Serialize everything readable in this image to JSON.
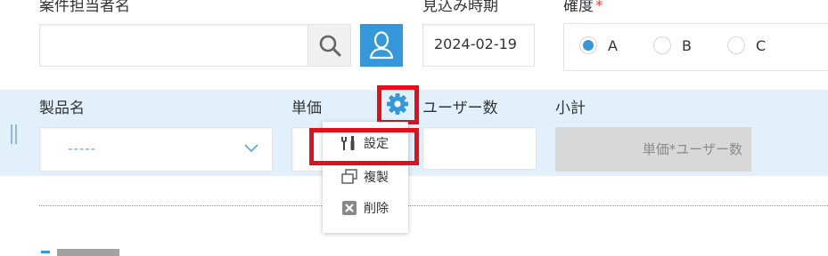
{
  "top_section": {
    "person_label": "案件担当者名",
    "person_value": "",
    "prospect_label": "見込み時期",
    "prospect_value": "2024-02-19",
    "certainty_label": "確度",
    "certainty_required_mark": "*",
    "certainty_options": [
      {
        "label": "A",
        "checked": true
      },
      {
        "label": "B",
        "checked": false
      },
      {
        "label": "C",
        "checked": false
      }
    ]
  },
  "table_section": {
    "product_label": "製品名",
    "product_placeholder": "-----",
    "unit_price_label": "単価",
    "users_label": "ユーザー数",
    "subtotal_label": "小計",
    "subtotal_placeholder": "単価*ユーザー数"
  },
  "context_menu": {
    "items": [
      {
        "label": "設定",
        "icon": "wrench-screwdriver-icon"
      },
      {
        "label": "複製",
        "icon": "duplicate-icon"
      },
      {
        "label": "削除",
        "icon": "delete-icon"
      }
    ]
  },
  "colors": {
    "accent": "#3498db",
    "highlight": "#e2101c",
    "row_bg": "#e1f0fa",
    "disabled_bg": "#d8d8d8"
  }
}
